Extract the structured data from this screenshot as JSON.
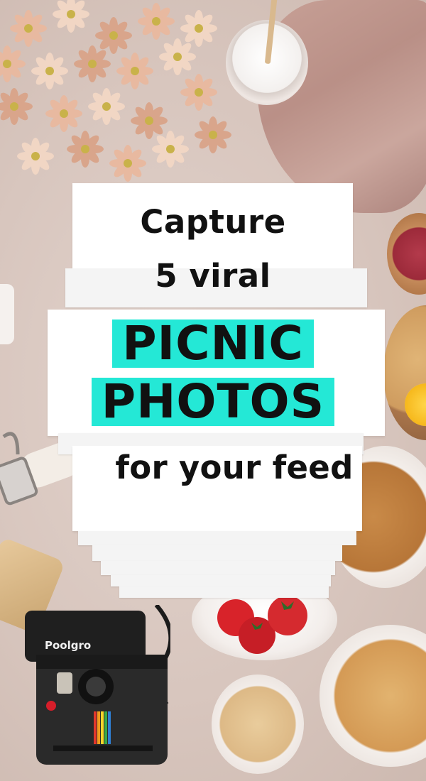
{
  "pin": {
    "line1": "Capture",
    "line2": "5 viral",
    "highlight1": "PICNIC",
    "highlight2": "PHOTOS",
    "line3": "for your feed",
    "highlight_color": "#24e8d6",
    "text_color": "#111111"
  },
  "scene": {
    "camera_brand": "Poolgro"
  }
}
